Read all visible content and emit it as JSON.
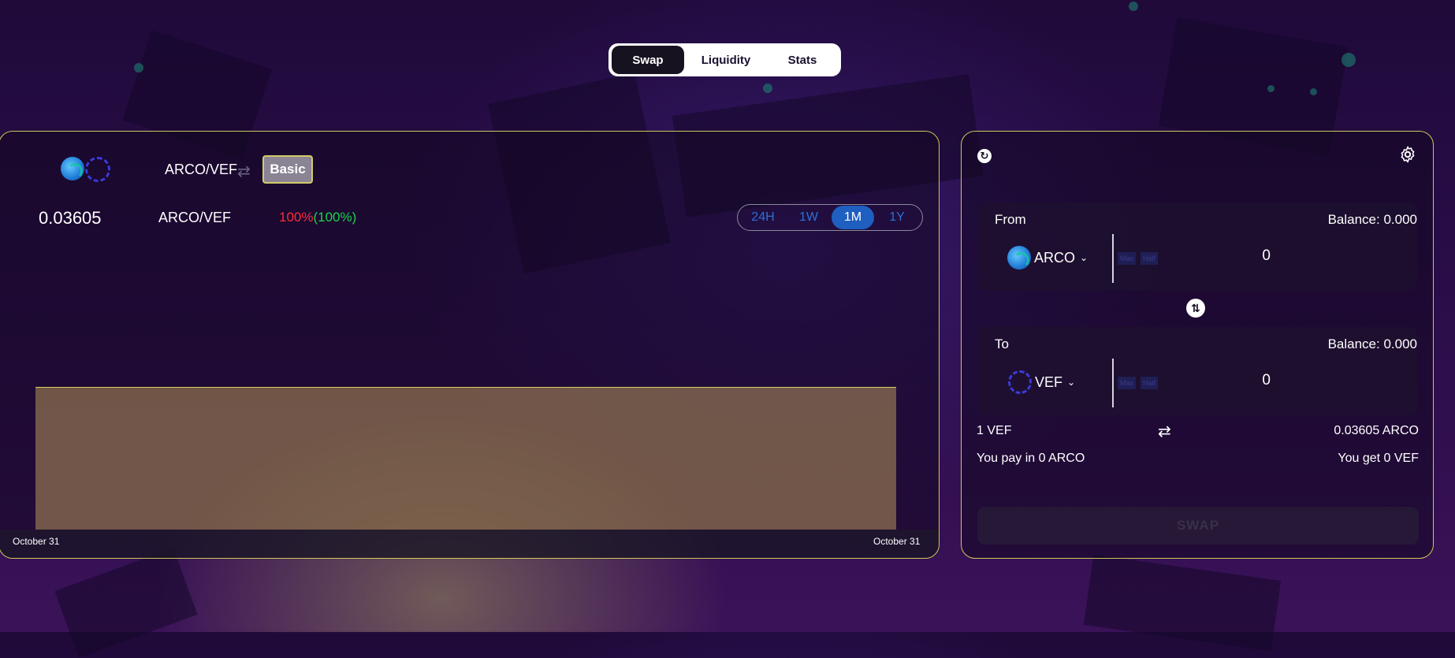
{
  "nav": {
    "tabs": [
      {
        "label": "Swap",
        "active": true
      },
      {
        "label": "Liquidity",
        "active": false
      },
      {
        "label": "Stats",
        "active": false
      }
    ]
  },
  "chart_panel": {
    "pair_title": "ARCO/VEF",
    "mode_button": "Basic",
    "price": "0.03605",
    "price_pair": "ARCO/VEF",
    "change_pct": "100%",
    "change_pct_paren": "(100%)",
    "ranges": [
      "24H",
      "1W",
      "1M",
      "1Y"
    ],
    "active_range": "1M",
    "date_start": "October 31",
    "date_end": "October 31"
  },
  "swap_panel": {
    "from": {
      "label": "From",
      "balance": "Balance: 0.000",
      "token": "ARCO",
      "amount": "0",
      "max_label": "Max",
      "half_label": "Half"
    },
    "to": {
      "label": "To",
      "balance": "Balance: 0.000",
      "token": "VEF",
      "amount": "0",
      "max_label": "Max",
      "half_label": "Half"
    },
    "rate_left": "1 VEF",
    "rate_right": "0.03605 ARCO",
    "you_pay": "You pay in 0 ARCO",
    "you_get": "You get 0 VEF",
    "swap_button": "SWAP"
  },
  "icons": {
    "refresh": "refresh-icon",
    "settings": "gear-icon",
    "flip": "swap-vertical-icon",
    "rate_toggle": "swap-horizontal-icon",
    "arco": "arco-token-icon",
    "vef": "vef-token-icon"
  },
  "colors": {
    "accent_border": "#cfc85a",
    "active_range": "#1e5fc0",
    "negative": "#ff2a3a",
    "positive": "#19d44a"
  }
}
